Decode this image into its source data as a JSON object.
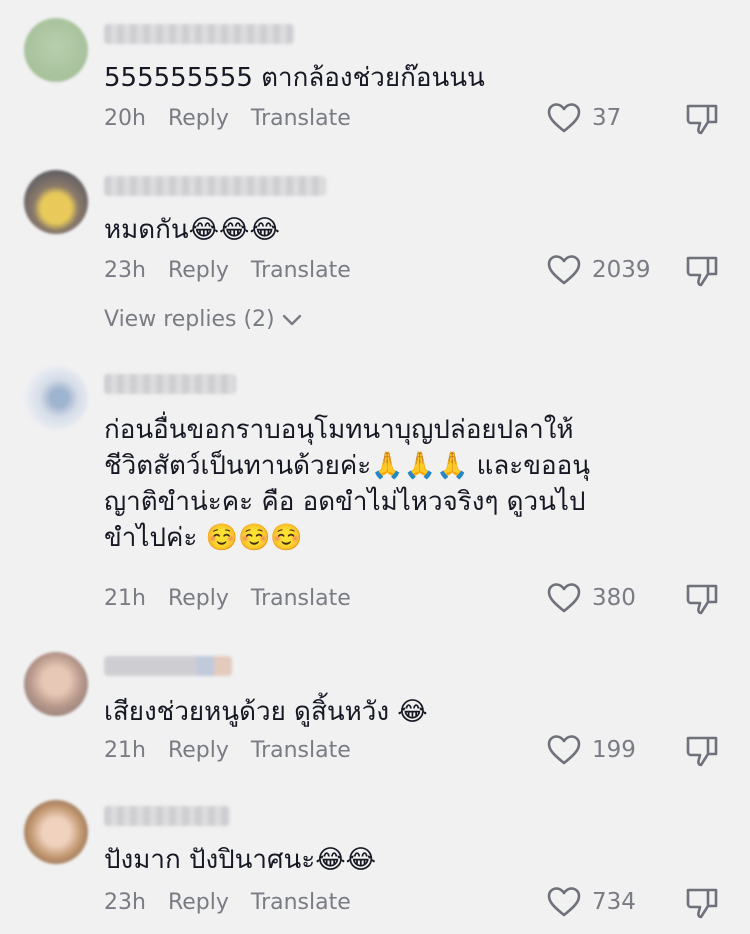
{
  "comments": [
    {
      "text": "555555555 ตากล้องช่วยก๊อนนน",
      "time": "20h",
      "reply": "Reply",
      "translate": "Translate",
      "likes": "37"
    },
    {
      "text": "หมดกัน😂😂😂",
      "time": "23h",
      "reply": "Reply",
      "translate": "Translate",
      "likes": "2039",
      "view_replies": "View replies (2)"
    },
    {
      "text": "ก่อนอื่นขอกราบอนุโมทนาบุญปล่อยปลาให้\nชีวิตสัตว์เป็นทานด้วยค่ะ🙏🙏🙏 และขออนุ\nญาติขำน่ะคะ คือ อดขำไม่ไหวจริงๆ ดูวนไป\nขำไปค่ะ ☺️☺️☺️",
      "time": "21h",
      "reply": "Reply",
      "translate": "Translate",
      "likes": "380"
    },
    {
      "text": "เสียงช่วยหนูด้วย ดูสิ้นหวัง 😂",
      "time": "21h",
      "reply": "Reply",
      "translate": "Translate",
      "likes": "199"
    },
    {
      "text": "ปังมาก ปังปินาศนะ😂😂",
      "time": "23h",
      "reply": "Reply",
      "translate": "Translate",
      "likes": "734"
    }
  ],
  "colors": {
    "background": "#f1f1f2",
    "text": "#161823",
    "secondary": "#7a7c84"
  },
  "icons": {
    "like": "heart-outline-icon",
    "dislike": "thumbs-down-icon",
    "expand": "chevron-down-icon"
  }
}
